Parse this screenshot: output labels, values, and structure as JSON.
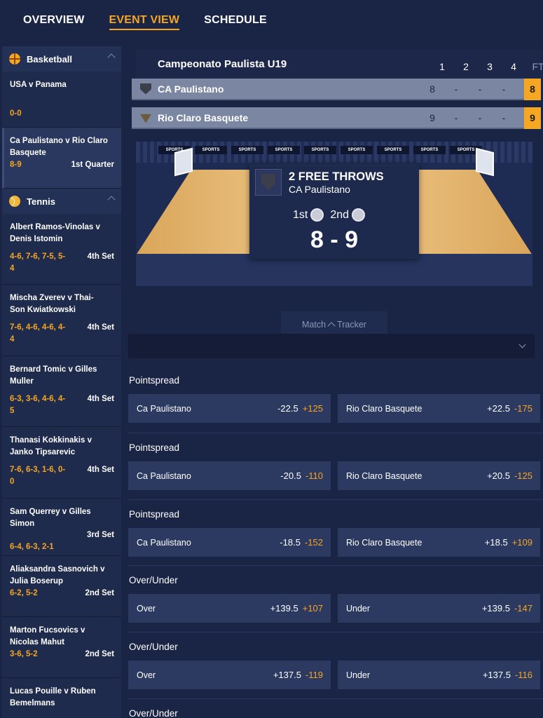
{
  "nav": {
    "tabs": [
      "OVERVIEW",
      "EVENT VIEW",
      "SCHEDULE"
    ]
  },
  "sidebar": {
    "basketball": {
      "label": "Basketball",
      "events": [
        {
          "name": "USA v Panama",
          "score": "0-0",
          "period": ""
        },
        {
          "name": "Ca Paulistano v Rio Claro Basquete",
          "score": "8-9",
          "period": "1st Quarter"
        }
      ]
    },
    "tennis": {
      "label": "Tennis",
      "events": [
        {
          "name": "Albert Ramos-Vinolas v Denis Istomin",
          "score": "4-6, 7-6, 7-5, 5-4",
          "period": "4th Set"
        },
        {
          "name": "Mischa Zverev v Thai-Son Kwiatkowski",
          "score": "7-6, 4-6, 4-6, 4-4",
          "period": "4th Set"
        },
        {
          "name": "Bernard Tomic v Gilles Muller",
          "score": "6-3, 3-6, 4-6, 4-5",
          "period": "4th Set"
        },
        {
          "name": "Thanasi Kokkinakis v Janko Tipsarevic",
          "score": "7-6, 6-3, 1-6, 0-0",
          "period": "4th Set"
        },
        {
          "name": "Sam Querrey v Gilles Simon",
          "score": "6-4, 6-3, 2-1",
          "period": "3rd Set"
        },
        {
          "name": "Aliaksandra Sasnovich v Julia Boserup",
          "score": "6-2, 5-2",
          "period": "2nd Set"
        },
        {
          "name": "Marton Fucsovics v Nicolas Mahut",
          "score": "3-6, 5-2",
          "period": "2nd Set"
        },
        {
          "name": "Lucas Pouille v Ruben Bemelmans",
          "score": "",
          "period": ""
        }
      ]
    }
  },
  "scoreboard": {
    "league": "Campeonato Paulista U19",
    "columns": [
      "1",
      "2",
      "3",
      "4",
      "FT"
    ],
    "teams": [
      {
        "name": "CA Paulistano",
        "q": [
          "8",
          "-",
          "-",
          "-"
        ],
        "ft": "8"
      },
      {
        "name": "Rio Claro Basquete",
        "q": [
          "9",
          "-",
          "-",
          "-"
        ],
        "ft": "9"
      }
    ]
  },
  "court": {
    "banner": "SPORTS",
    "event_title": "2 FREE THROWS",
    "event_team": "CA Paulistano",
    "half1": "1st",
    "half2": "2nd",
    "score": "8 - 9"
  },
  "tracker": {
    "left": "Match",
    "right": "Tracker"
  },
  "markets": [
    {
      "title": "Pointspread",
      "bets": [
        {
          "label": "Ca Paulistano",
          "line": "-22.5",
          "odds": "+125"
        },
        {
          "label": "Rio Claro Basquete",
          "line": "+22.5",
          "odds": "-175"
        }
      ]
    },
    {
      "title": "Pointspread",
      "bets": [
        {
          "label": "Ca Paulistano",
          "line": "-20.5",
          "odds": "-110"
        },
        {
          "label": "Rio Claro Basquete",
          "line": "+20.5",
          "odds": "-125"
        }
      ]
    },
    {
      "title": "Pointspread",
      "bets": [
        {
          "label": "Ca Paulistano",
          "line": "-18.5",
          "odds": "-152"
        },
        {
          "label": "Rio Claro Basquete",
          "line": "+18.5",
          "odds": "+109"
        }
      ]
    },
    {
      "title": "Over/Under",
      "bets": [
        {
          "label": "Over",
          "line": "+139.5",
          "odds": "+107"
        },
        {
          "label": "Under",
          "line": "+139.5",
          "odds": "-147"
        }
      ]
    },
    {
      "title": "Over/Under",
      "bets": [
        {
          "label": "Over",
          "line": "+137.5",
          "odds": "-119"
        },
        {
          "label": "Under",
          "line": "+137.5",
          "odds": "-116"
        }
      ]
    },
    {
      "title": "Over/Under",
      "bets": []
    }
  ],
  "colors": {
    "accent": "#f5a623",
    "background": "#1a2444",
    "bet_button": "#2c3a62"
  }
}
